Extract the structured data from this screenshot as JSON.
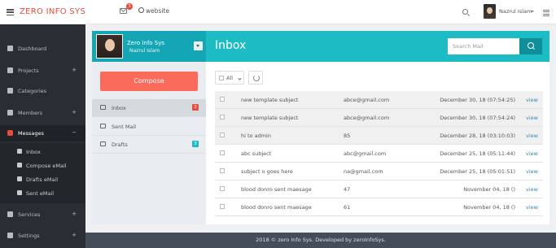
{
  "header": {
    "brand": "ZERO INFO SYS",
    "mail_badge": "3",
    "website_label": "website",
    "user_name": "Nazrul Islam"
  },
  "sidebar": {
    "items": [
      {
        "label": "Dashboard",
        "icon": "dashboard-icon"
      },
      {
        "label": "Projects",
        "icon": "cart-icon"
      },
      {
        "label": "Categories",
        "icon": "tag-icon"
      },
      {
        "label": "Members",
        "icon": "users-icon"
      },
      {
        "label": "Messages",
        "icon": "envelope-icon"
      },
      {
        "label": "Services",
        "icon": "exchange-icon"
      },
      {
        "label": "Settings",
        "icon": "gear-icon"
      }
    ],
    "messages_submenu": [
      {
        "label": "Inbox",
        "icon": "inbox-icon"
      },
      {
        "label": "Compose eMail",
        "icon": "compose-icon"
      },
      {
        "label": "Drafts eMail",
        "icon": "drafts-icon"
      },
      {
        "label": "Sent eMail",
        "icon": "send-icon"
      }
    ]
  },
  "profile": {
    "name": "Zero Info Sys",
    "sub": "Nazrul Islam"
  },
  "inbox": {
    "title": "Inbox",
    "search_placeholder": "Search Mail",
    "filter_label": "All"
  },
  "compose_label": "Compose",
  "folders": [
    {
      "label": "Inbox",
      "count": "3",
      "count_color": "#e74c3c"
    },
    {
      "label": "Sent Mail",
      "count": "",
      "count_color": ""
    },
    {
      "label": "Drafts",
      "count": "3",
      "count_color": "#1dbcc4"
    }
  ],
  "mails": [
    {
      "subject": "new template subject",
      "from": "abce@gmail.com",
      "date": "December 30, 18 (07:54:25)",
      "action": "view",
      "read": true
    },
    {
      "subject": "new template subject",
      "from": "abce@gmail.com",
      "date": "December 30, 18 (07:54:24)",
      "action": "view",
      "read": true
    },
    {
      "subject": "hi to admin",
      "from": "85",
      "date": "December 28, 18 (03:10:03)",
      "action": "view",
      "read": true
    },
    {
      "subject": "abc subject",
      "from": "abc@gmail.com",
      "date": "December 25, 18 (05:11:44)",
      "action": "view",
      "read": false
    },
    {
      "subject": "subject o goes here",
      "from": "na@gmail.com",
      "date": "December 25, 18 (05:01:51)",
      "action": "view",
      "read": false
    },
    {
      "subject": "blood donro sent maesage",
      "from": "47",
      "date": "November 04, 18 ()",
      "action": "view",
      "read": false
    },
    {
      "subject": "blood donro sent maesage",
      "from": "61",
      "date": "November 04, 18 ()",
      "action": "view",
      "read": false
    }
  ],
  "footer": "2018 © zero Info Sys. Developed by zeroInfoSys."
}
